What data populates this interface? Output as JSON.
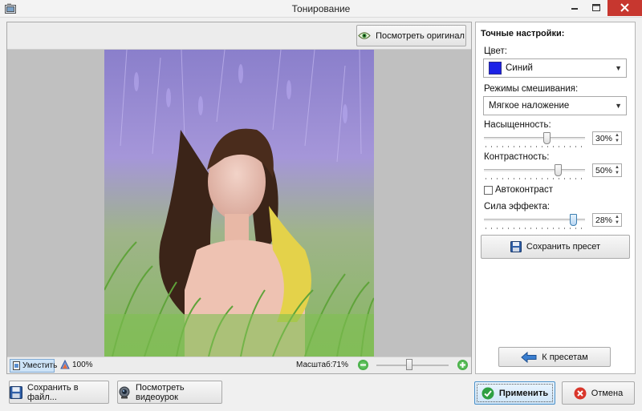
{
  "window": {
    "title": "Тонирование"
  },
  "preview": {
    "view_original_label": "Посмотреть оригинал",
    "fit_label": "Уместить",
    "zoom100_label": "100%",
    "scale_label": "Масштаб:",
    "scale_value": "71%",
    "zoom_slider_value": 0.45
  },
  "settings": {
    "heading": "Точные настройки:",
    "color_label": "Цвет:",
    "color_value": "Синий",
    "color_swatch": "#1c22e6",
    "blend_label": "Режимы смешивания:",
    "blend_value": "Мягкое наложение",
    "saturation_label": "Насыщенность:",
    "saturation_value": "30%",
    "saturation_level": 0.62,
    "contrast_label": "Контрастность:",
    "contrast_value": "50%",
    "contrast_level": 0.73,
    "autocontrast_label": "Автоконтраст",
    "autocontrast_checked": false,
    "strength_label": "Сила эффекта:",
    "strength_value": "28%",
    "strength_level": 0.88,
    "save_preset_label": "Сохранить пресет",
    "back_to_presets_label": "К пресетам"
  },
  "footer": {
    "save_file_label": "Сохранить в файл...",
    "watch_video_label": "Посмотреть видеоурок",
    "apply_label": "Применить",
    "cancel_label": "Отмена"
  },
  "icons": {
    "app": "app-icon",
    "minimize": "minimize-icon",
    "maximize": "maximize-icon",
    "close": "close-icon",
    "eye": "eye-icon",
    "fit": "fit-icon",
    "zoom100": "zoom-100-icon",
    "zoom_out": "zoom-out-icon",
    "zoom_in": "zoom-in-icon",
    "save": "floppy-disk-icon",
    "back": "arrow-left-icon",
    "video": "webcam-icon",
    "apply": "checkmark-icon",
    "cancel": "cancel-icon"
  },
  "colors": {
    "accent": "#4a90c8",
    "apply_check": "#2ea043",
    "cancel": "#d9362b"
  }
}
